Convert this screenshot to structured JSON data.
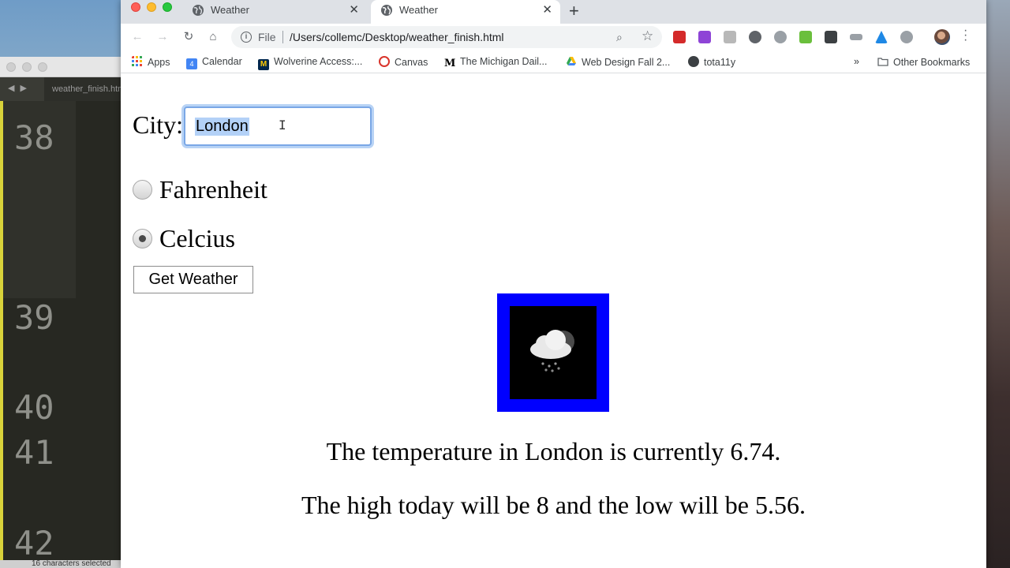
{
  "browser": {
    "tabs": [
      {
        "label": "Weather",
        "active": false
      },
      {
        "label": "Weather",
        "active": true
      }
    ],
    "address": {
      "scheme_label": "File",
      "url": "/Users/collemc/Desktop/weather_finish.html"
    },
    "bookmarks": [
      {
        "label": "Apps",
        "icon": "apps-grid-icon"
      },
      {
        "label": "Calendar",
        "icon": "calendar-icon"
      },
      {
        "label": "Wolverine Access:...",
        "icon": "michigan-m-icon"
      },
      {
        "label": "Canvas",
        "icon": "canvas-icon"
      },
      {
        "label": "The Michigan Dail...",
        "icon": "michigan-daily-icon"
      },
      {
        "label": "Web Design Fall 2...",
        "icon": "google-drive-icon"
      },
      {
        "label": "tota11y",
        "icon": "tota11y-icon"
      }
    ],
    "overflow_label": "»",
    "other_bookmarks": "Other Bookmarks",
    "calendar_day": "4"
  },
  "editor": {
    "tab_label": "weather_finish.html",
    "line_numbers": [
      "38",
      "39",
      "40",
      "41",
      "42"
    ],
    "status": "16 characters selected"
  },
  "form": {
    "city_label": "City:",
    "city_value": "London",
    "unit_options": [
      {
        "label": "Fahrenheit",
        "checked": false
      },
      {
        "label": "Celcius",
        "checked": true
      }
    ],
    "submit_label": "Get Weather"
  },
  "weather": {
    "icon": "cloud-snow-night-icon",
    "frame_color": "#0000ff",
    "temperature_line": "The temperature in London is currently 6.74.",
    "high_low_line": "The high today will be 8 and the low will be 5.56."
  },
  "colors": {
    "focus_ring": "#7aa7e6",
    "selection": "#b3d1f7"
  }
}
